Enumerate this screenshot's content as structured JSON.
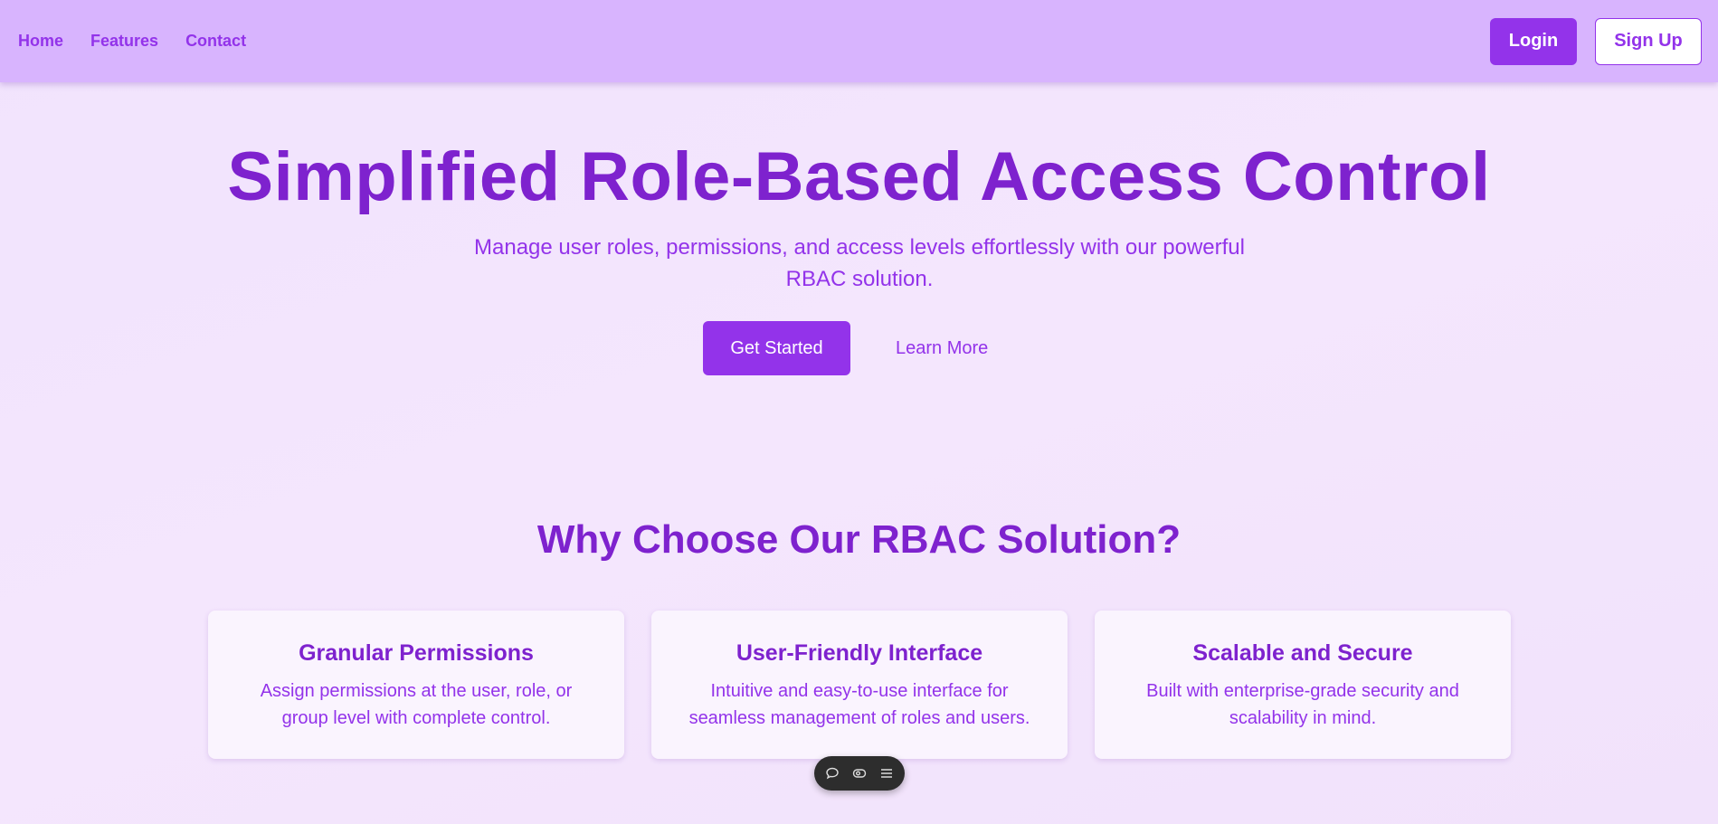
{
  "header": {
    "nav": [
      "Home",
      "Features",
      "Contact"
    ],
    "login_label": "Login",
    "signup_label": "Sign Up"
  },
  "hero": {
    "title": "Simplified Role-Based Access Control",
    "subtitle": "Manage user roles, permissions, and access levels effortlessly with our powerful RBAC solution.",
    "primary_cta": "Get Started",
    "secondary_cta": "Learn More"
  },
  "features": {
    "title": "Why Choose Our RBAC Solution?",
    "cards": [
      {
        "title": "Granular Permissions",
        "text": "Assign permissions at the user, role, or group level with complete control."
      },
      {
        "title": "User-Friendly Interface",
        "text": "Intuitive and easy-to-use interface for seamless management of roles and users."
      },
      {
        "title": "Scalable and Secure",
        "text": "Built with enterprise-grade security and scalability in mind."
      }
    ]
  },
  "toolbar": {
    "icons": [
      "comment-icon",
      "eye-icon",
      "menu-icon"
    ]
  },
  "colors": {
    "accent": "#9333ea",
    "heading": "#7e22ce",
    "header_bg": "#d8b4fe"
  }
}
